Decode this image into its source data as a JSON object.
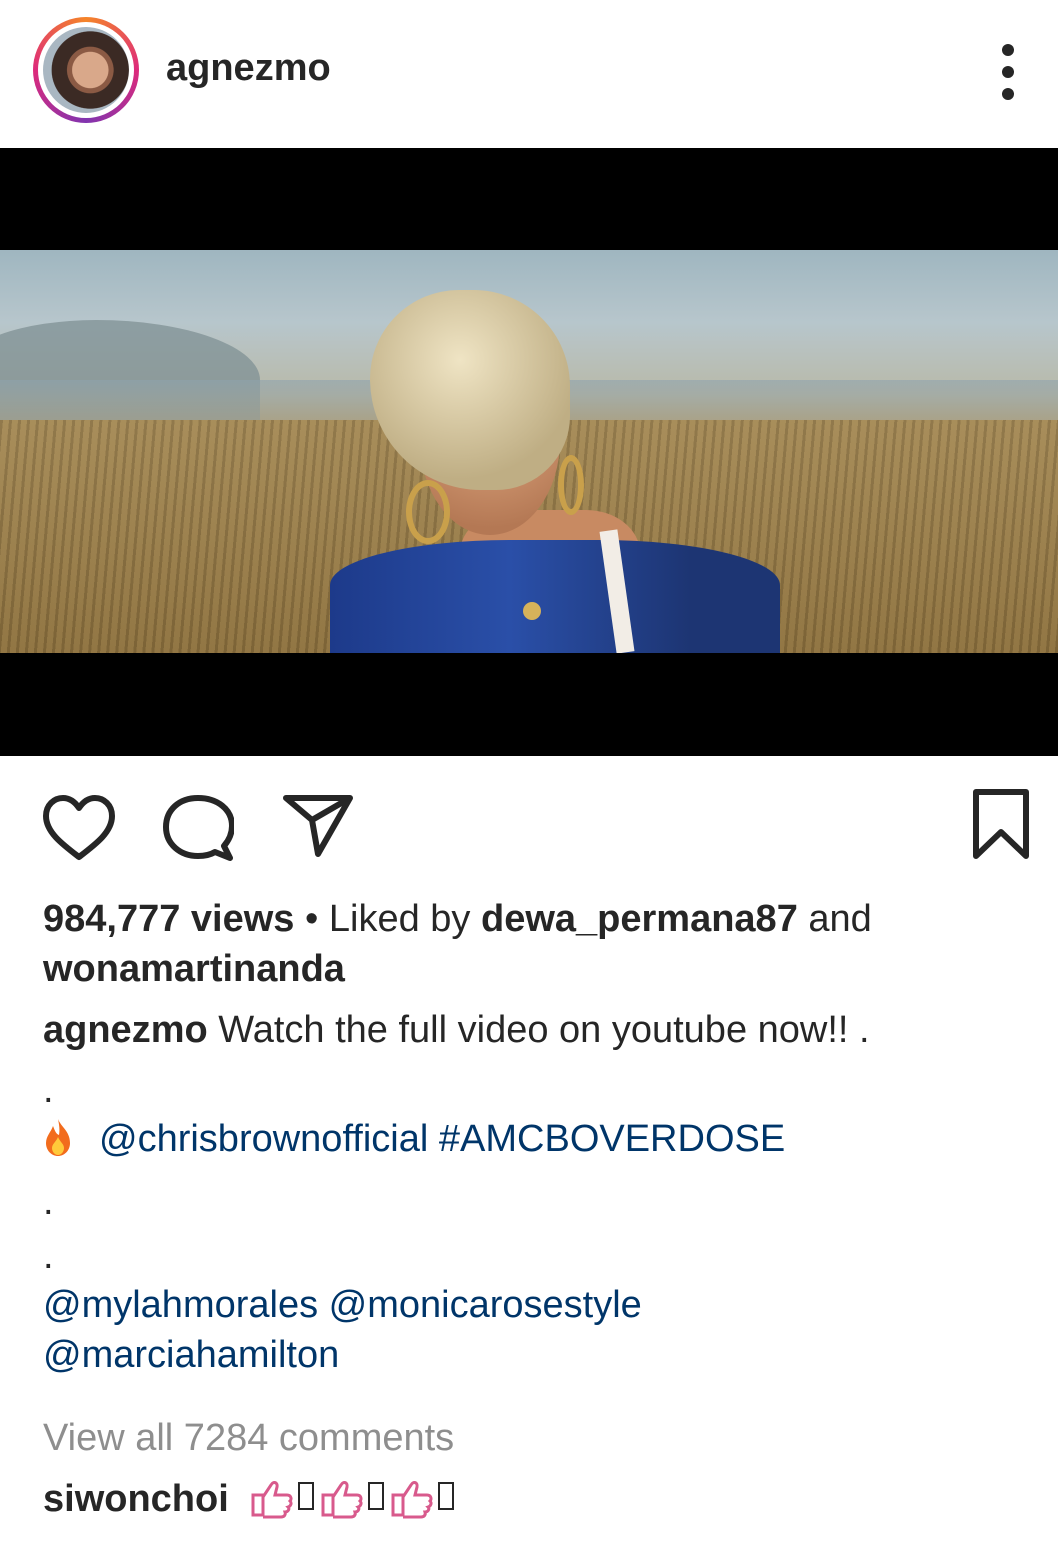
{
  "header": {
    "username": "agnezmo"
  },
  "stats": {
    "views": "984,777 views",
    "separator": "•",
    "liked_by_prefix": "Liked by",
    "liked_by_user_1": "dewa_permana87",
    "liked_by_and": "and",
    "liked_by_user_2": "wonamartinanda"
  },
  "caption": {
    "author": "agnezmo",
    "text": "Watch the full video on youtube now!! .",
    "dot": ".",
    "fire_icon": "fire-emoji",
    "mention_1": "@chrisbrownofficial",
    "hashtag": "#AMCBOVERDOSE",
    "mention_2": "@mylahmorales",
    "mention_3": "@monicarosestyle",
    "mention_4": "@marciahamilton"
  },
  "comments": {
    "view_all": "View all 7284 comments",
    "first_author": "siwonchoi",
    "first_text_icon": "thumbs-up-emoji"
  },
  "colors": {
    "text": "#262626",
    "link": "#003569",
    "muted": "#8e8e8e"
  }
}
